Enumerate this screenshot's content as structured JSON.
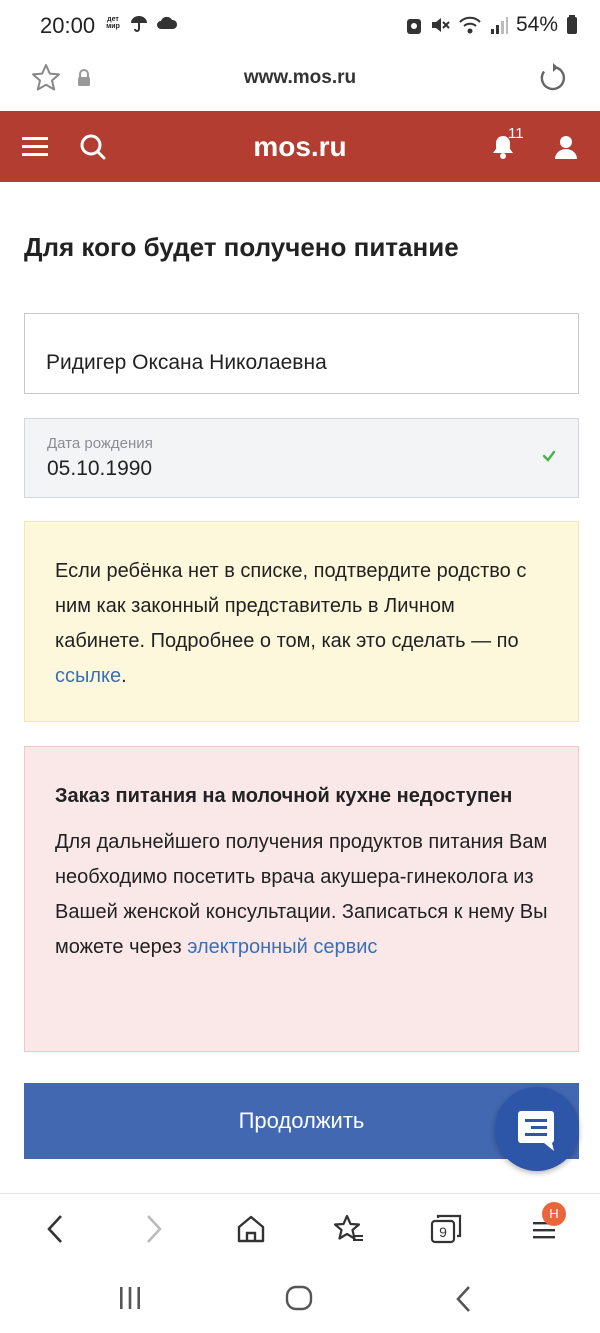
{
  "status_bar": {
    "time": "20:00",
    "detmir_logo": "дет мир",
    "battery": "54%"
  },
  "browser": {
    "url": "www.mos.ru",
    "tabs_count": "9",
    "menu_badge": "H"
  },
  "header": {
    "site_title": "mos.ru",
    "notifications_count": "11"
  },
  "page": {
    "title": "Для кого будет получено питание",
    "recipient_name": "Ридигер Оксана Николаевна",
    "dob_label": "Дата рождения",
    "dob_value": "05.10.1990"
  },
  "info_notice": {
    "text": "Если ребёнка нет в списке, подтвердите родство с ним как законный представитель в Личном кабинете. Подробнее о том, как это сделать — по ",
    "link_text": "ссылке",
    "text_end": "."
  },
  "warning_notice": {
    "title": "Заказ питания на молочной кухне недоступен",
    "text": "Для дальнейшего получения продуктов питания Вам необходимо посетить врача акушера-гинеколога из Вашей женской консультации. Записаться к нему Вы можете через ",
    "link_text": "электронный сервис"
  },
  "actions": {
    "continue_label": "Продолжить"
  },
  "colors": {
    "header_bg": "#b33d31",
    "primary_button": "#4268b1",
    "link": "#3b6fb6",
    "info_bg": "#fdf7dc",
    "warning_bg": "#f9e8e7",
    "check_green": "#4caf50"
  },
  "icons": {
    "status_left": [
      "detmir-icon",
      "umbrella-icon",
      "cloud-icon"
    ],
    "status_right": [
      "vpn-icon",
      "mute-icon",
      "wifi-icon",
      "signal-icon",
      "battery-icon"
    ],
    "toolbar": [
      "back-icon",
      "forward-icon",
      "home-icon",
      "bookmarks-icon",
      "tabs-icon",
      "menu-icon"
    ],
    "nav": [
      "recents-icon",
      "home-icon",
      "back-icon"
    ]
  }
}
